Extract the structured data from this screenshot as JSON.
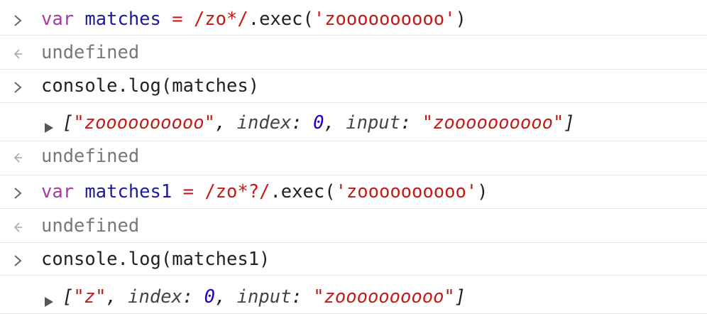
{
  "console": {
    "lines": [
      {
        "kind": "input",
        "tokens": [
          {
            "text": "var",
            "cls": "kw"
          },
          {
            "text": " ",
            "cls": "plain"
          },
          {
            "text": "matches",
            "cls": "var"
          },
          {
            "text": " = ",
            "cls": "regex"
          },
          {
            "text": "/zo*/",
            "cls": "regex"
          },
          {
            "text": ".exec(",
            "cls": "plain"
          },
          {
            "text": "'zoooooooooo'",
            "cls": "str"
          },
          {
            "text": ")",
            "cls": "plain"
          }
        ]
      },
      {
        "kind": "result",
        "text": "undefined"
      },
      {
        "kind": "input",
        "tokens": [
          {
            "text": "console.log(matches)",
            "cls": "plain"
          }
        ]
      },
      {
        "kind": "log-object",
        "tokens": [
          {
            "text": "[",
            "cls": "plain"
          },
          {
            "text": "\"zoooooooooo\"",
            "cls": "str"
          },
          {
            "text": ", ",
            "cls": "plain"
          },
          {
            "text": "index",
            "cls": "key"
          },
          {
            "text": ": ",
            "cls": "plain"
          },
          {
            "text": "0",
            "cls": "num"
          },
          {
            "text": ", ",
            "cls": "plain"
          },
          {
            "text": "input",
            "cls": "key"
          },
          {
            "text": ": ",
            "cls": "plain"
          },
          {
            "text": "\"zoooooooooo\"",
            "cls": "str"
          },
          {
            "text": "]",
            "cls": "plain"
          }
        ]
      },
      {
        "kind": "result",
        "text": "undefined"
      },
      {
        "kind": "input",
        "tokens": [
          {
            "text": "var",
            "cls": "kw"
          },
          {
            "text": " ",
            "cls": "plain"
          },
          {
            "text": "matches1",
            "cls": "var"
          },
          {
            "text": " = ",
            "cls": "regex"
          },
          {
            "text": "/zo*?/",
            "cls": "regex"
          },
          {
            "text": ".exec(",
            "cls": "plain"
          },
          {
            "text": "'zoooooooooo'",
            "cls": "str"
          },
          {
            "text": ")",
            "cls": "plain"
          }
        ]
      },
      {
        "kind": "result",
        "text": "undefined"
      },
      {
        "kind": "input",
        "tokens": [
          {
            "text": "console.log(matches1)",
            "cls": "plain"
          }
        ]
      },
      {
        "kind": "log-object",
        "tokens": [
          {
            "text": "[",
            "cls": "plain"
          },
          {
            "text": "\"z\"",
            "cls": "str"
          },
          {
            "text": ", ",
            "cls": "plain"
          },
          {
            "text": "index",
            "cls": "key"
          },
          {
            "text": ": ",
            "cls": "plain"
          },
          {
            "text": "0",
            "cls": "num"
          },
          {
            "text": ", ",
            "cls": "plain"
          },
          {
            "text": "input",
            "cls": "key"
          },
          {
            "text": ": ",
            "cls": "plain"
          },
          {
            "text": "\"zoooooooooo\"",
            "cls": "str"
          },
          {
            "text": "]",
            "cls": "plain"
          }
        ]
      }
    ]
  },
  "icons": {
    "input": "chevron-right-icon",
    "result": "return-arrow-icon",
    "expand": "disclosure-triangle-icon"
  },
  "colors": {
    "keyword": "#a73aa0",
    "variable": "#1d1a9e",
    "string": "#c41a16",
    "result": "#777777",
    "divider": "#e6e6e6"
  }
}
